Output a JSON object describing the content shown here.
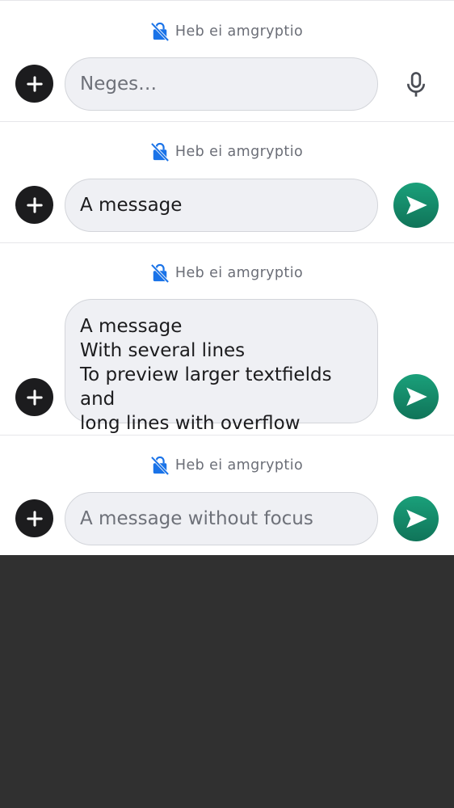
{
  "encryption_label": "Heb ei amgryptio",
  "icons": {
    "lock": "lock-off-icon",
    "add": "plus-icon",
    "mic": "microphone-icon",
    "send": "send-icon"
  },
  "colors": {
    "lock_blue": "#1a73e8",
    "send_green": "#138a68",
    "add_dark": "#1c1c1e",
    "background_dark": "#303030"
  },
  "composers": [
    {
      "encryption_label": "Heb ei amgryptio",
      "field_placeholder": "Neges…",
      "action": "mic"
    },
    {
      "encryption_label": "Heb ei amgryptio",
      "field_value": "A message",
      "action": "send"
    },
    {
      "encryption_label": "Heb ei amgryptio",
      "field_lines": [
        "A message",
        "With several lines",
        "To preview larger textfields and",
        "long lines with overflow"
      ],
      "action": "send"
    },
    {
      "encryption_label": "Heb ei amgryptio",
      "field_value": "A message without focus",
      "action": "send"
    }
  ]
}
